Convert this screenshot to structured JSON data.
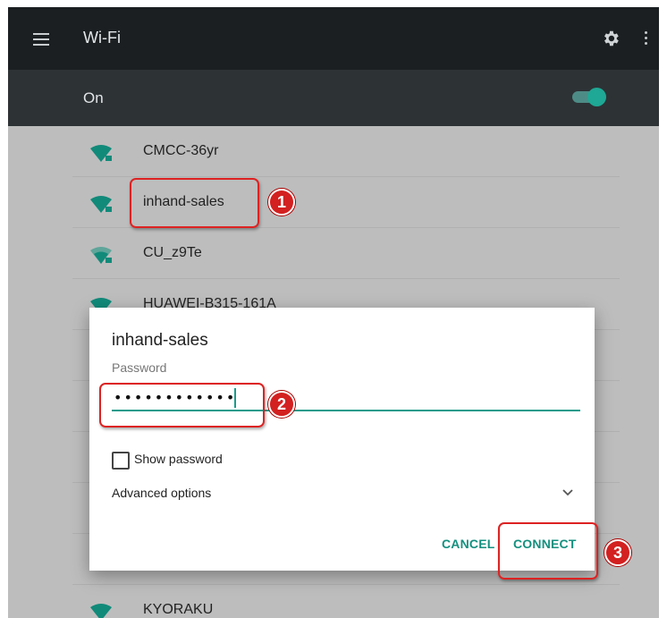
{
  "toolbar": {
    "title": "Wi-Fi"
  },
  "onbar": {
    "label": "On",
    "enabled": true
  },
  "networks": [
    {
      "ssid": "CMCC-36yr"
    },
    {
      "ssid": "inhand-sales"
    },
    {
      "ssid": "CU_z9Te"
    },
    {
      "ssid": "HUAWEI-B315-161A"
    },
    {
      "ssid": ""
    },
    {
      "ssid": ""
    },
    {
      "ssid": ""
    },
    {
      "ssid": ""
    },
    {
      "ssid": ""
    },
    {
      "ssid": "KYORAKU"
    }
  ],
  "dialog": {
    "title": "inhand-sales",
    "password_label": "Password",
    "password_value": "••••••••••••",
    "show_password_label": "Show password",
    "show_password_checked": false,
    "advanced_label": "Advanced options",
    "cancel_label": "CANCEL",
    "connect_label": "CONNECT"
  },
  "annotations": {
    "step1": "1",
    "step2": "2",
    "step3": "3"
  },
  "colors": {
    "accent": "#14907f",
    "annotation": "#d32020",
    "toolbar": "#1c1f21"
  }
}
